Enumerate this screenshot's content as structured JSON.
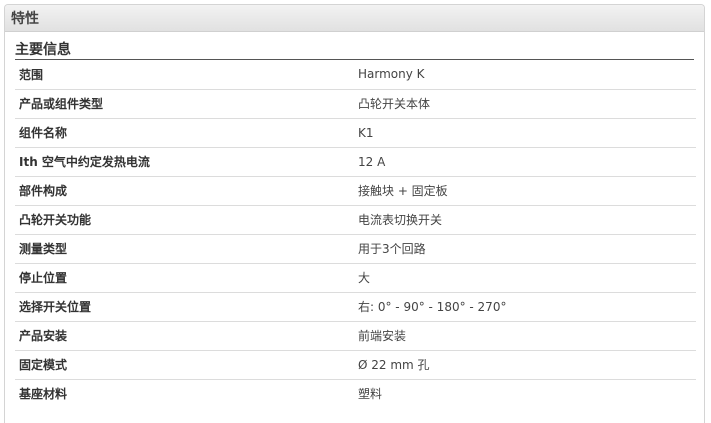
{
  "panel": {
    "title": "特性"
  },
  "section": {
    "title": "主要信息"
  },
  "rows": [
    {
      "label": "范围",
      "value": "Harmony K"
    },
    {
      "label": "产品或组件类型",
      "value": "凸轮开关本体"
    },
    {
      "label": "组件名称",
      "value": "K1"
    },
    {
      "label": "Ith 空气中约定发热电流",
      "value": "12 A"
    },
    {
      "label": "部件构成",
      "value": "接触块 + 固定板"
    },
    {
      "label": "凸轮开关功能",
      "value": "电流表切换开关"
    },
    {
      "label": "测量类型",
      "value": "用于3个回路"
    },
    {
      "label": "停止位置",
      "value": "大"
    },
    {
      "label": "选择开关位置",
      "value": "右: 0° - 90° - 180° - 270°"
    },
    {
      "label": "产品安装",
      "value": "前端安装"
    },
    {
      "label": "固定模式",
      "value": "Ø 22 mm 孔"
    },
    {
      "label": "基座材料",
      "value": "塑料"
    }
  ]
}
